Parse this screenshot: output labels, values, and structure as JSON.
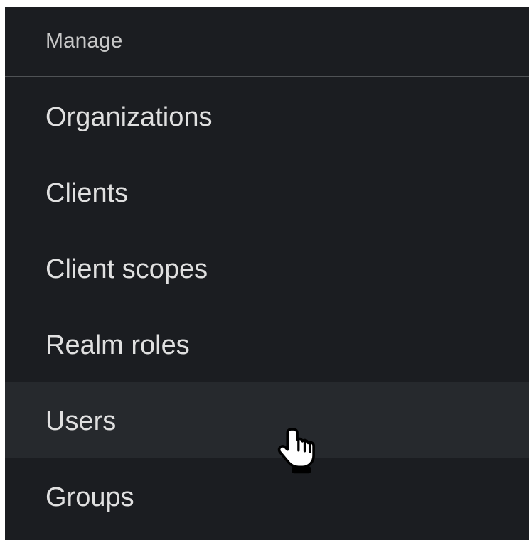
{
  "nav": {
    "section_title": "Manage",
    "items": [
      {
        "label": "Organizations"
      },
      {
        "label": "Clients"
      },
      {
        "label": "Client scopes"
      },
      {
        "label": "Realm roles"
      },
      {
        "label": "Users",
        "state": "hovered"
      },
      {
        "label": "Groups"
      }
    ]
  },
  "cursor": {
    "icon": "hand-pointer-icon"
  },
  "colors": {
    "nav_background": "#1b1d21",
    "hover_background": "#26292d",
    "item_text": "#e0e0e0",
    "section_text": "#c7c7c7",
    "divider": "#4f5255"
  }
}
